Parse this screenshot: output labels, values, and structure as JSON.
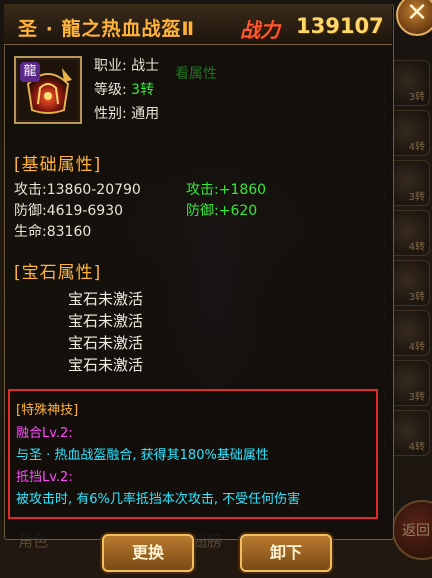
{
  "item": {
    "name": "圣 · 龍之热血战盔Ⅱ",
    "icon_glyph": "龍",
    "power_label": "战力",
    "power_value": "139107"
  },
  "info": {
    "class_label": "职业:",
    "class_value": "战士",
    "level_label": "等级:",
    "level_value": "3转",
    "gender_label": "性别:",
    "gender_value": "通用",
    "faint_link": "看属性"
  },
  "base_attr": {
    "title": "[基础属性]",
    "attack": "攻击:13860-20790",
    "defense": "防御:4619-6930",
    "hp": "生命:83160",
    "attack_bonus": "攻击:+1860",
    "defense_bonus": "防御:+620"
  },
  "gem_attr": {
    "title": "[宝石属性]",
    "slots": [
      "宝石未激活",
      "宝石未激活",
      "宝石未激活",
      "宝石未激活"
    ]
  },
  "special": {
    "title": "[特殊神技]",
    "skill1_name": "融合Lv.2:",
    "skill1_desc": "与圣 · 热血战盔融合, 获得其180%基础属性",
    "skill2_name": "抵挡Lv.2:",
    "skill2_desc": "被攻击时, 有6%几率抵挡本次攻击, 不受任何伤害"
  },
  "buttons": {
    "replace": "更换",
    "unequip": "卸下",
    "close": "✕"
  },
  "background": {
    "slot_labels": [
      "3转",
      "4转",
      "3转",
      "4转",
      "3转",
      "4转",
      "3转",
      "4转"
    ],
    "bottom_left": "角色",
    "bottom_mid": "翅膀",
    "return_label": "返回"
  }
}
